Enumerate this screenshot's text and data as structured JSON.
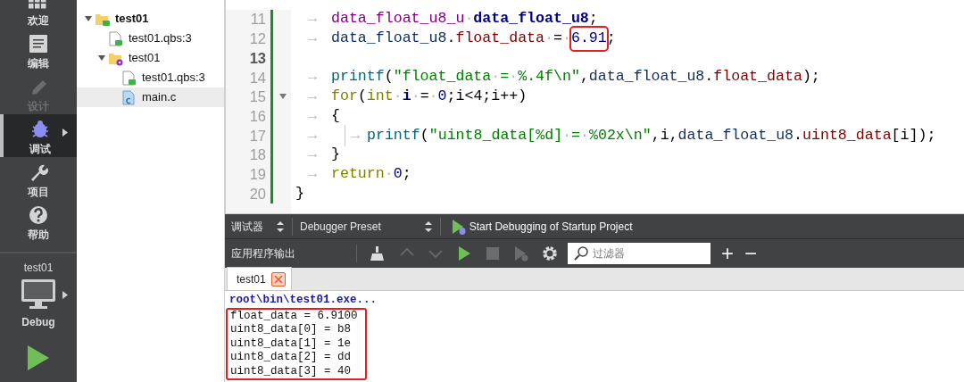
{
  "sidebar": {
    "modes": [
      {
        "label": "欢迎",
        "selected": false,
        "disabled": false
      },
      {
        "label": "编辑",
        "selected": false,
        "disabled": false
      },
      {
        "label": "设计",
        "selected": false,
        "disabled": true
      },
      {
        "label": "调试",
        "selected": true,
        "disabled": false
      },
      {
        "label": "项目",
        "selected": false,
        "disabled": false
      },
      {
        "label": "帮助",
        "selected": false,
        "disabled": false
      }
    ],
    "project": "test01",
    "build": "Debug"
  },
  "tree": [
    {
      "label": "test01",
      "kind": "project",
      "active": true,
      "expanded": true,
      "selected": false,
      "children": [
        {
          "label": "test01.qbs:3",
          "kind": "build-file",
          "selected": false
        },
        {
          "label": "test01",
          "kind": "product",
          "expanded": true,
          "selected": false,
          "children": [
            {
              "label": "test01.qbs:3",
              "kind": "build-file",
              "selected": false
            },
            {
              "label": "main.c",
              "kind": "source",
              "selected": true
            }
          ]
        }
      ]
    }
  ],
  "editor": {
    "lines": [
      {
        "number": "11",
        "current": false,
        "tokens": [
          {
            "text": "→",
            "kind": "tab"
          },
          {
            "text": "data_float_u8_u",
            "kind": "type"
          },
          {
            "text": "·",
            "kind": "space"
          },
          {
            "text": "data_float_u8",
            "kind": "decl"
          },
          {
            "text": ";",
            "kind": "plain"
          }
        ]
      },
      {
        "number": "12",
        "current": false,
        "tokens": [
          {
            "text": "→",
            "kind": "tab"
          },
          {
            "text": "data_float_u8",
            "kind": "var"
          },
          {
            "text": ".",
            "kind": "plain"
          },
          {
            "text": "float_data",
            "kind": "field"
          },
          {
            "text": "·",
            "kind": "space"
          },
          {
            "text": "=",
            "kind": "plain"
          },
          {
            "text": "·",
            "kind": "space"
          },
          {
            "text": "6.91",
            "kind": "number",
            "boxed": true
          },
          {
            "text": ";",
            "kind": "plain"
          }
        ]
      },
      {
        "number": "13",
        "current": true
      },
      {
        "number": "14",
        "current": false,
        "tokens": [
          {
            "text": "→",
            "kind": "tab"
          },
          {
            "text": "printf",
            "kind": "func"
          },
          {
            "text": "(",
            "kind": "plain"
          },
          {
            "text": "\"float_data",
            "kind": "string"
          },
          {
            "text": "·",
            "kind": "space"
          },
          {
            "text": "=",
            "kind": "string"
          },
          {
            "text": "·",
            "kind": "space"
          },
          {
            "text": "%.4f\\n\"",
            "kind": "string"
          },
          {
            "text": ",",
            "kind": "plain"
          },
          {
            "text": "data_float_u8",
            "kind": "var"
          },
          {
            "text": ".",
            "kind": "plain"
          },
          {
            "text": "float_data",
            "kind": "field"
          },
          {
            "text": ");",
            "kind": "plain"
          }
        ]
      },
      {
        "number": "15",
        "current": false,
        "foldable": true,
        "tokens": [
          {
            "text": "→",
            "kind": "tab"
          },
          {
            "text": "for",
            "kind": "keyword"
          },
          {
            "text": "(",
            "kind": "plain"
          },
          {
            "text": "int",
            "kind": "keyword"
          },
          {
            "text": "·",
            "kind": "space"
          },
          {
            "text": "i",
            "kind": "decl"
          },
          {
            "text": "·",
            "kind": "space"
          },
          {
            "text": "=",
            "kind": "plain"
          },
          {
            "text": "·",
            "kind": "space"
          },
          {
            "text": "0",
            "kind": "number"
          },
          {
            "text": ";i<4;i++)",
            "kind": "plain"
          }
        ]
      },
      {
        "number": "16",
        "current": false,
        "tokens": [
          {
            "text": "→",
            "kind": "tab"
          },
          {
            "text": "{",
            "kind": "plain"
          }
        ]
      },
      {
        "number": "17",
        "current": false,
        "tokens": [
          {
            "text": "→",
            "kind": "tab"
          },
          {
            "text": "→",
            "kind": "guide-tab"
          },
          {
            "text": "printf",
            "kind": "func"
          },
          {
            "text": "(",
            "kind": "plain"
          },
          {
            "text": "\"uint8_data[%d]",
            "kind": "string"
          },
          {
            "text": "·",
            "kind": "space"
          },
          {
            "text": "=",
            "kind": "string"
          },
          {
            "text": "·",
            "kind": "space"
          },
          {
            "text": "%02x\\n\"",
            "kind": "string"
          },
          {
            "text": ",i,",
            "kind": "plain"
          },
          {
            "text": "data_float_u8",
            "kind": "var"
          },
          {
            "text": ".",
            "kind": "plain"
          },
          {
            "text": "uint8_data",
            "kind": "field"
          },
          {
            "text": "[i]);",
            "kind": "plain"
          }
        ]
      },
      {
        "number": "18",
        "current": false,
        "tokens": [
          {
            "text": "→",
            "kind": "tab"
          },
          {
            "text": "}",
            "kind": "plain"
          }
        ]
      },
      {
        "number": "19",
        "current": false,
        "tokens": [
          {
            "text": "→",
            "kind": "tab"
          },
          {
            "text": "return",
            "kind": "keyword"
          },
          {
            "text": "·",
            "kind": "space"
          },
          {
            "text": "0",
            "kind": "number"
          },
          {
            "text": ";",
            "kind": "plain"
          }
        ]
      },
      {
        "number": "20",
        "current": false,
        "tokens": [
          {
            "text": "}",
            "kind": "plain"
          }
        ]
      }
    ]
  },
  "debugger_bar": {
    "label": "调试器",
    "preset": "Debugger Preset",
    "start_button": "Start Debugging of Startup Project"
  },
  "output_pane": {
    "title": "应用程序输出",
    "tools": [
      {
        "kind": "clean",
        "disabled": false
      },
      {
        "kind": "previous",
        "disabled": true
      },
      {
        "kind": "next",
        "disabled": true
      },
      {
        "kind": "run",
        "disabled": false
      },
      {
        "kind": "stop",
        "disabled": true
      },
      {
        "kind": "debug",
        "disabled": true
      },
      {
        "kind": "settings",
        "disabled": false
      }
    ],
    "filter": {
      "placeholder": "过滤器"
    },
    "zoom_in": "+",
    "zoom_out": "−",
    "tabs": [
      {
        "label": "test01",
        "selected": true
      }
    ],
    "lines": [
      {
        "text": "root\\bin\\test01.exe...",
        "kind": "info",
        "marked": false
      },
      {
        "text": "float_data = 6.9100",
        "kind": "stdout",
        "marked": true
      },
      {
        "text": "uint8_data[0] = b8",
        "kind": "stdout",
        "marked": true
      },
      {
        "text": "uint8_data[1] = 1e",
        "kind": "stdout",
        "marked": true
      },
      {
        "text": "uint8_data[2] = dd",
        "kind": "stdout",
        "marked": true
      },
      {
        "text": "uint8_data[3] = 40",
        "kind": "stdout",
        "marked": true
      }
    ]
  }
}
